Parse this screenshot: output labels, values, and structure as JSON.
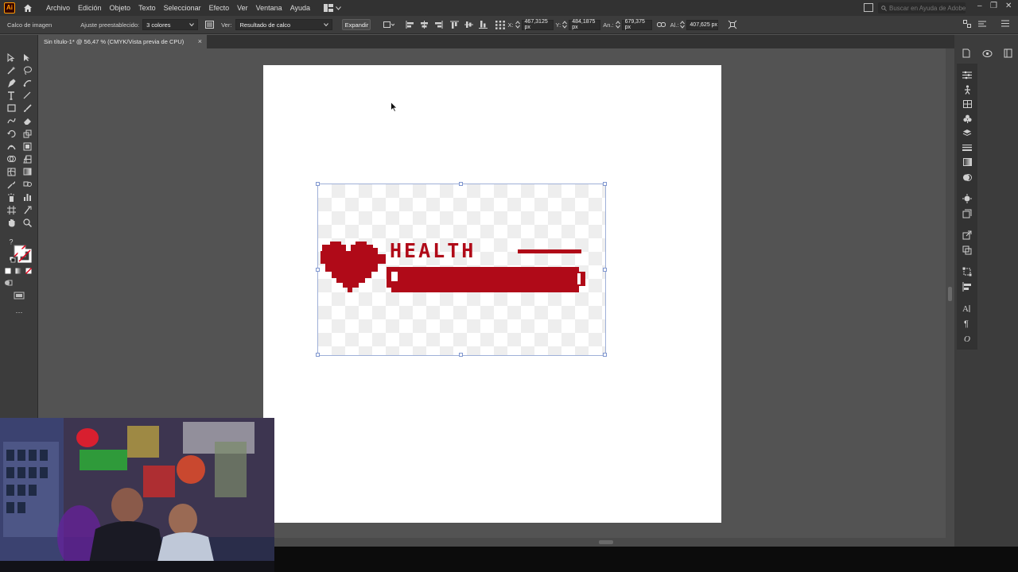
{
  "app": {
    "logo_text": "Ai",
    "menu": [
      "Archivo",
      "Edición",
      "Objeto",
      "Texto",
      "Seleccionar",
      "Efecto",
      "Ver",
      "Ventana",
      "Ayuda"
    ],
    "search_placeholder": "Buscar en Ayuda de Adobe"
  },
  "controlbar": {
    "panel_name": "Calco de imagen",
    "preset_label": "Ajuste preestablecido:",
    "preset_value": "3 colores",
    "view_label": "Ver:",
    "view_value": "Resultado de calco",
    "expand_label": "Expandir",
    "x_label": "X:",
    "x_value": "467,3125 px",
    "y_label": "Y:",
    "y_value": "484,1875 px",
    "w_label": "An.:",
    "w_value": "679,375 px",
    "h_label": "Al.:",
    "h_value": "407,625 px"
  },
  "document": {
    "tab_title": "Sin título-1* @ 56,47 % (CMYK/Vista previa de CPU)",
    "close_glyph": "×"
  },
  "artwork": {
    "text": "HEALTH",
    "color": "#b00a18"
  },
  "toolbar": {
    "more_glyph": "···"
  }
}
